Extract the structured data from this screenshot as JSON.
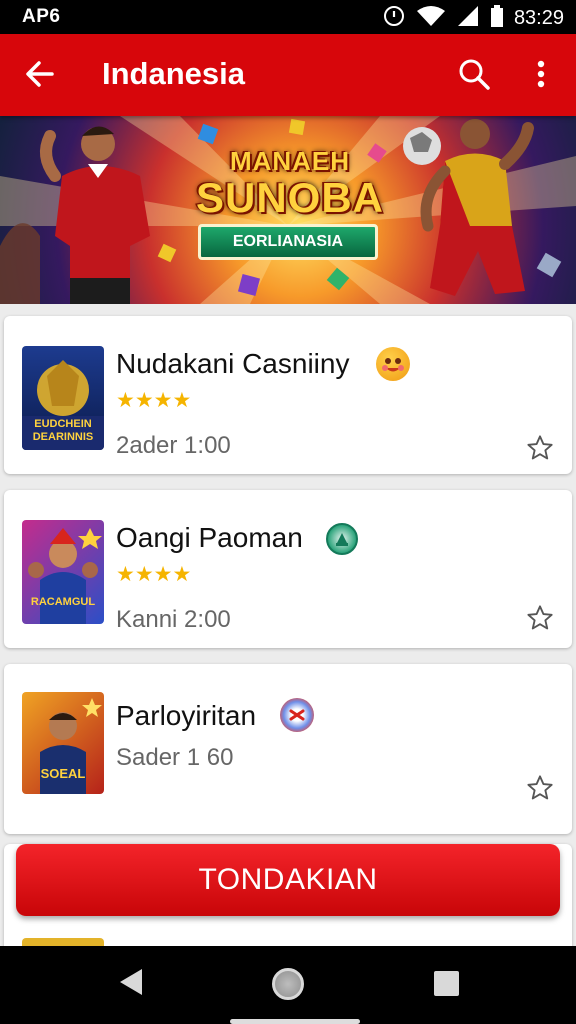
{
  "status_bar": {
    "carrier": "AP6",
    "time": "83:29"
  },
  "app_bar": {
    "title": "Indanesia"
  },
  "banner": {
    "line1": "MANAEH",
    "line2": "SUNOBA",
    "ribbon": "EORLIANASIA"
  },
  "items": [
    {
      "name": "Nudakani Casniiny",
      "rating": "★★★★",
      "subtitle": "2ader 1:00",
      "thumb_label": "EUDCHEIN DEARINNIS"
    },
    {
      "name": "Oangi Paoman",
      "rating": "★★★★",
      "subtitle": "Kanni 2:00",
      "thumb_label": "RACAMGUL"
    },
    {
      "name": "Parloyiritan",
      "rating": "",
      "subtitle": "Sader 1 60",
      "thumb_label": "SOEAL"
    }
  ],
  "cta": {
    "label": "TONDAKIAN"
  },
  "colors": {
    "primary": "#d7060b",
    "star": "#f5b400"
  }
}
